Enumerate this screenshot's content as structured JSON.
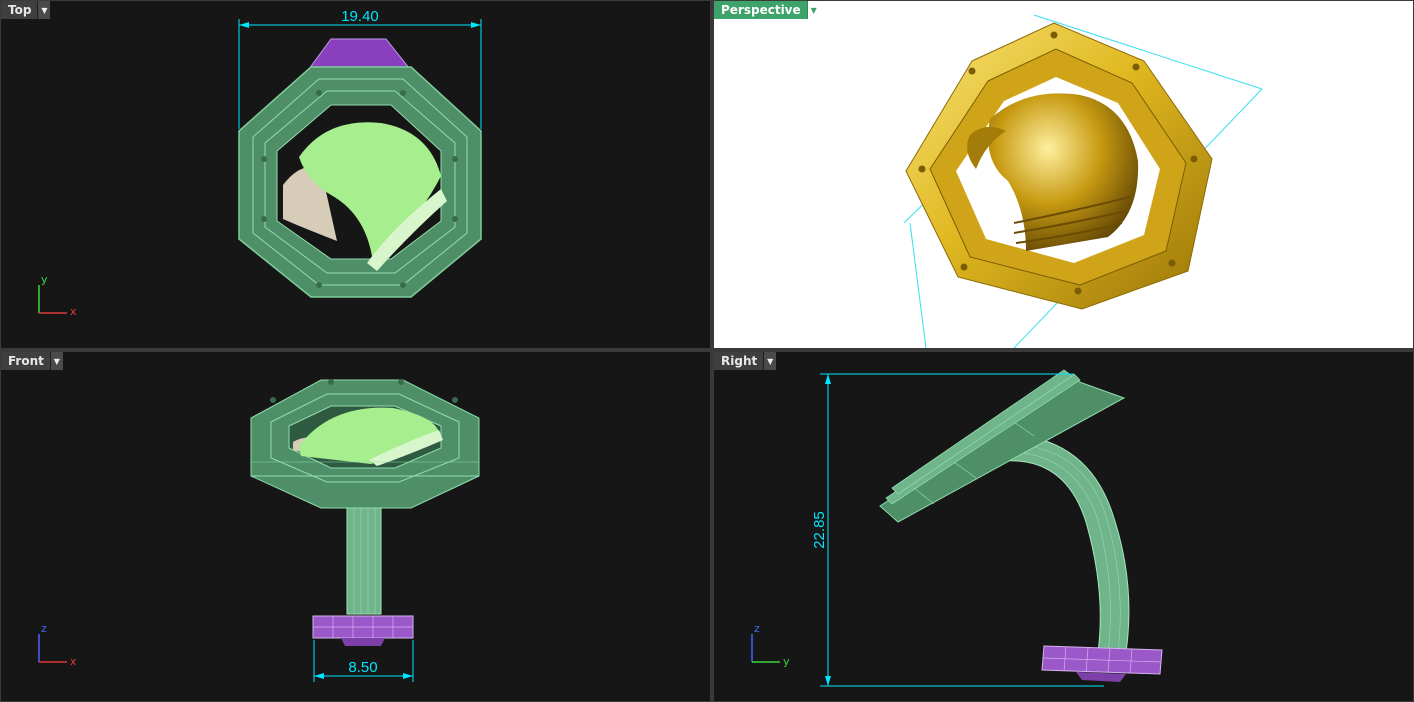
{
  "viewports": {
    "top": {
      "title": "Top",
      "dropdown_icon": "triangle-down",
      "axes": {
        "vertical": "y",
        "horizontal": "x"
      }
    },
    "perspective": {
      "title": "Perspective",
      "dropdown_icon": "triangle-down"
    },
    "front": {
      "title": "Front",
      "dropdown_icon": "triangle-down",
      "axes": {
        "vertical": "z",
        "horizontal": "x"
      }
    },
    "right": {
      "title": "Right",
      "dropdown_icon": "triangle-down",
      "axes": {
        "vertical": "z",
        "horizontal": "y"
      }
    }
  },
  "dimensions": {
    "top_width": "19.40",
    "front_shank_width": "8.50",
    "right_height": "22.85"
  },
  "colors": {
    "viewport_bg": "#161616",
    "perspective_bg": "#ffffff",
    "active_tab": "#3ea26b",
    "wireframe_green": "#5faa7e",
    "surface_lime": "#a6ee8e",
    "surface_cream": "#d6ccb8",
    "purple_part": "#9b58c9",
    "dimension_line": "#00e6ff",
    "gold_render": "#e0b820"
  }
}
